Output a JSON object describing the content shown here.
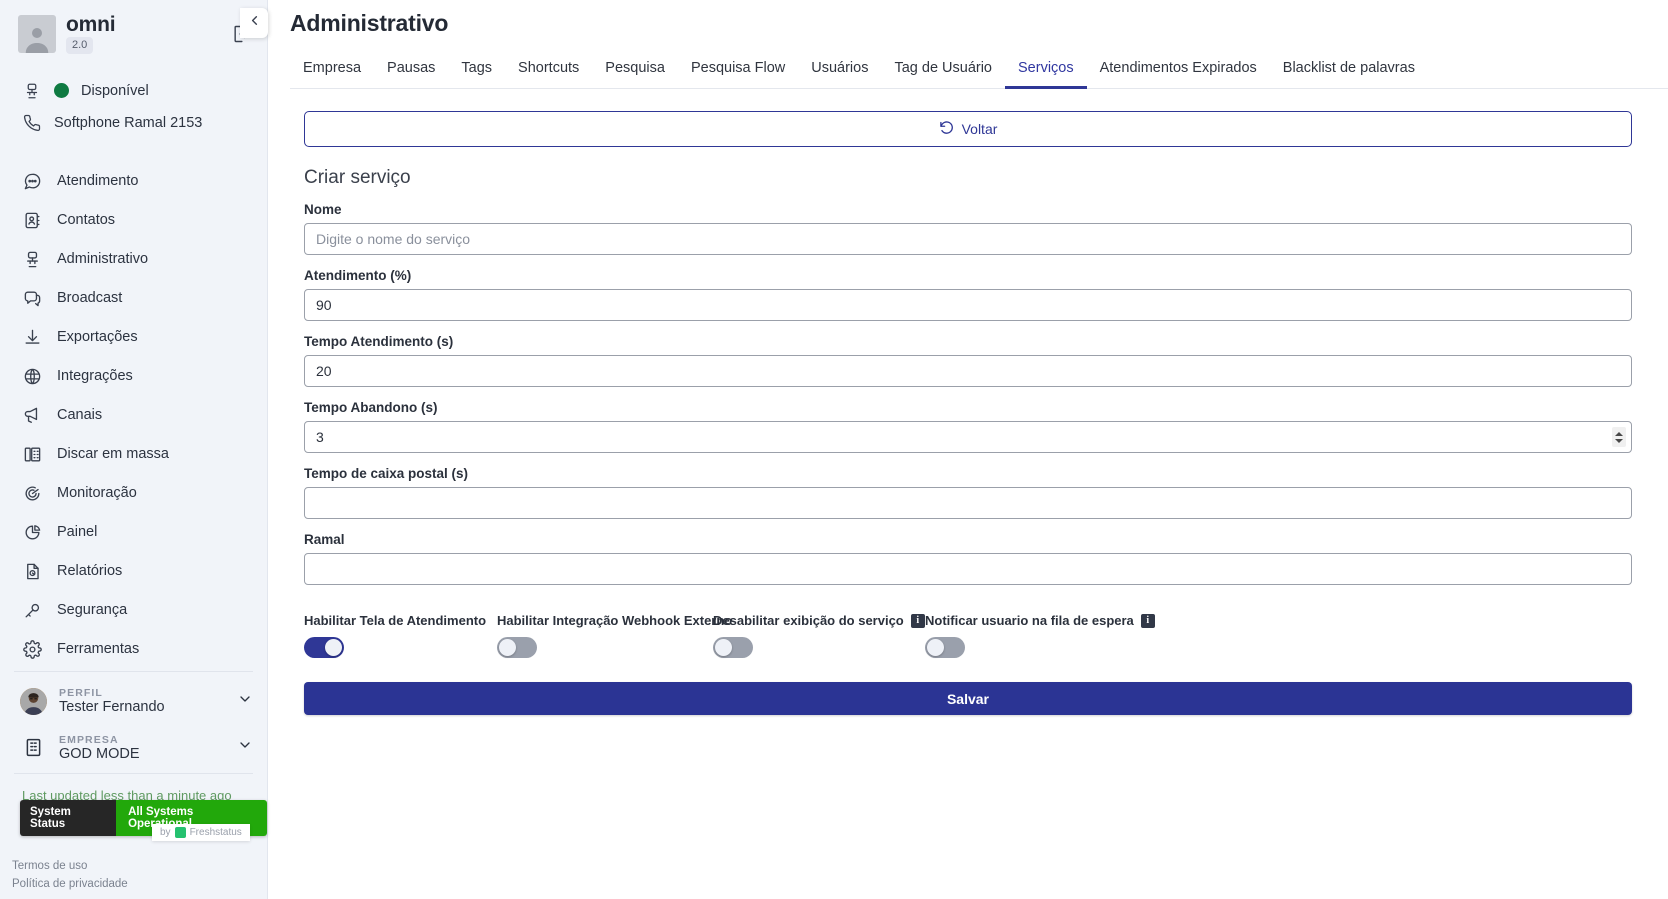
{
  "sidebar": {
    "brand": {
      "name": "omni",
      "version": "2.0"
    },
    "logout_icon": "logout-icon",
    "status": {
      "label": "Disponível",
      "icon": "agent-desk-icon"
    },
    "softphone": {
      "label": "Softphone Ramal 2153",
      "icon": "phone-icon"
    },
    "menu": [
      {
        "label": "Atendimento",
        "icon": "chat-bubble-icon"
      },
      {
        "label": "Contatos",
        "icon": "contact-book-icon"
      },
      {
        "label": "Administrativo",
        "icon": "agent-desk-icon"
      },
      {
        "label": "Broadcast",
        "icon": "broadcast-chat-icon"
      },
      {
        "label": "Exportações",
        "icon": "download-icon"
      },
      {
        "label": "Integrações",
        "icon": "globe-icon"
      },
      {
        "label": "Canais",
        "icon": "megaphone-icon"
      },
      {
        "label": "Discar em massa",
        "icon": "dialer-icon"
      },
      {
        "label": "Monitoração",
        "icon": "target-icon"
      },
      {
        "label": "Painel",
        "icon": "pie-chart-icon"
      },
      {
        "label": "Relatórios",
        "icon": "report-file-icon"
      },
      {
        "label": "Segurança",
        "icon": "key-icon"
      },
      {
        "label": "Ferramentas",
        "icon": "gear-icon"
      }
    ],
    "profile": {
      "caption": "PERFIL",
      "value": "Tester Fernando"
    },
    "company": {
      "caption": "EMPRESA",
      "value": "GOD MODE"
    },
    "system_status": {
      "last_updated": "Last updated less than a minute ago",
      "badge_left": "System Status",
      "badge_right": "All Systems Operational",
      "by_label": "by",
      "by_brand": "Freshstatus"
    },
    "legal": {
      "terms": "Termos de uso",
      "privacy": "Política de privacidade"
    },
    "collapse_icon": "chevron-left-icon"
  },
  "header": {
    "title": "Administrativo",
    "tabs": [
      {
        "label": "Empresa",
        "active": false
      },
      {
        "label": "Pausas",
        "active": false
      },
      {
        "label": "Tags",
        "active": false
      },
      {
        "label": "Shortcuts",
        "active": false
      },
      {
        "label": "Pesquisa",
        "active": false
      },
      {
        "label": "Pesquisa Flow",
        "active": false
      },
      {
        "label": "Usuários",
        "active": false
      },
      {
        "label": "Tag de Usuário",
        "active": false
      },
      {
        "label": "Serviços",
        "active": true
      },
      {
        "label": "Atendimentos Expirados",
        "active": false
      },
      {
        "label": "Blacklist de palavras",
        "active": false
      }
    ]
  },
  "form": {
    "back_button": "Voltar",
    "back_icon": "rotate-left-icon",
    "section_title": "Criar serviço",
    "fields": [
      {
        "label": "Nome",
        "value": "",
        "placeholder": "Digite o nome do serviço",
        "spinner": false
      },
      {
        "label": "Atendimento (%)",
        "value": "90",
        "placeholder": "",
        "spinner": false
      },
      {
        "label": "Tempo Atendimento (s)",
        "value": "20",
        "placeholder": "",
        "spinner": false
      },
      {
        "label": "Tempo Abandono (s)",
        "value": "3",
        "placeholder": "",
        "spinner": true
      },
      {
        "label": "Tempo de caixa postal (s)",
        "value": "",
        "placeholder": "",
        "spinner": false
      },
      {
        "label": "Ramal",
        "value": "",
        "placeholder": "",
        "spinner": false
      }
    ],
    "toggles": [
      {
        "label": "Habilitar Tela de Atendimento",
        "state": "on",
        "info": false
      },
      {
        "label": "Habilitar Integração Webhook Externo",
        "state": "off",
        "info": false
      },
      {
        "label": "Desabilitar exibição do serviço",
        "state": "off",
        "info": true
      },
      {
        "label": "Notificar usuario na fila de espera",
        "state": "off",
        "info": true
      }
    ],
    "info_icon_glyph": "i",
    "save_button": "Salvar"
  },
  "colors": {
    "brand_blue": "#2f3796",
    "save_blue": "#2b3494",
    "sidebar_bg": "#f1f4f9",
    "status_green": "#0f7a42",
    "ops_green": "#22a80b"
  }
}
